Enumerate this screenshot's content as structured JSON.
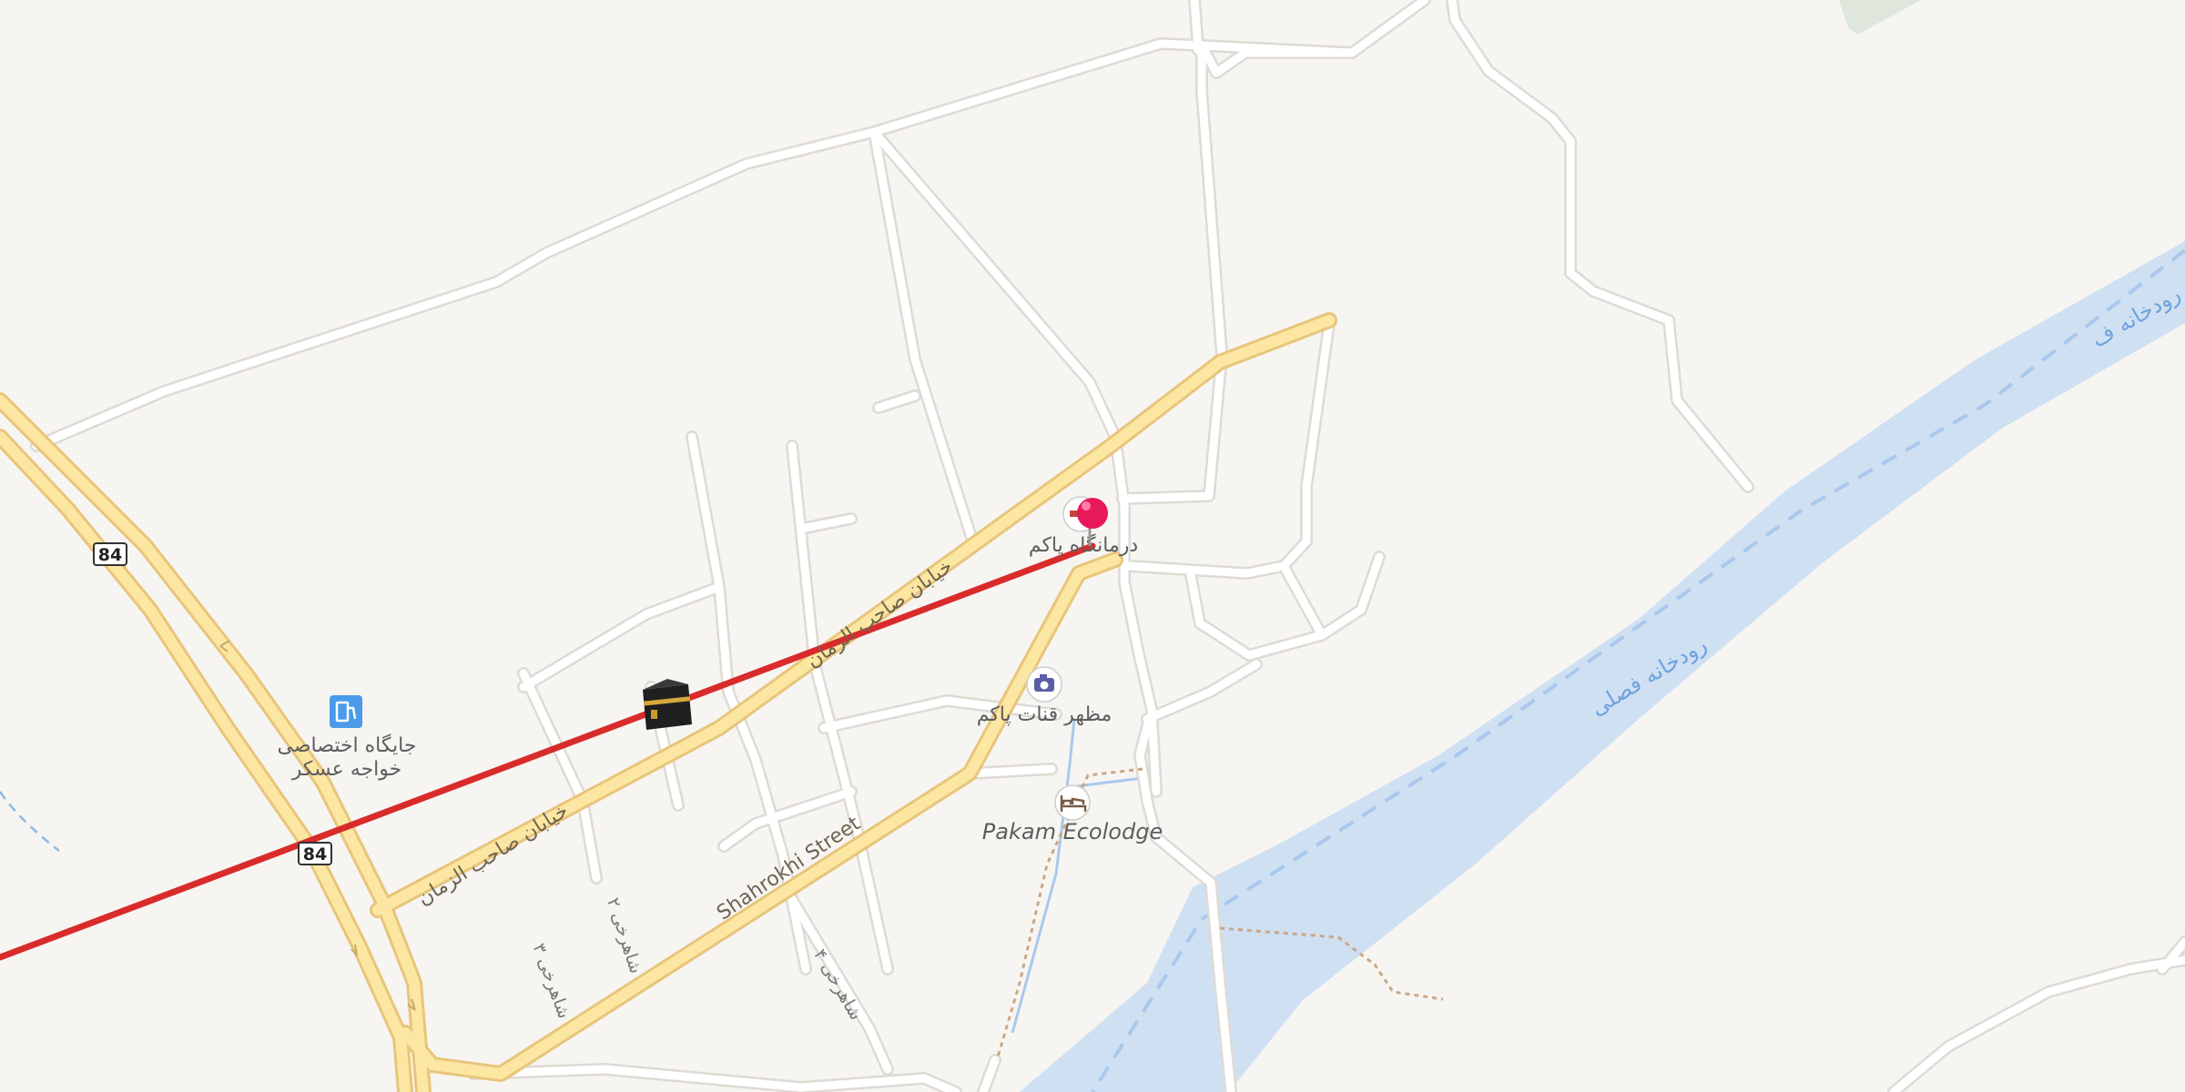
{
  "map": {
    "pois": {
      "fuel_label_line1": "جایگاه اختصاصی",
      "fuel_label_line2": "خواجه عسکر",
      "clinic_label": "درمانگاه پاکم",
      "viewpoint_label": "مظهر قنات پاکم",
      "lodge_label": "Pakam Ecolodge"
    },
    "streets": {
      "shahrokhi": "Shahrokhi Street",
      "saheb_upper": "خیابان صاحب الزمان",
      "saheb_lower": "خیابان صاحب الزمان",
      "shahrokhi_3": "شاهرخی ۳",
      "shahrokhi_2": "شاهرخی ۲",
      "shahrokhi_4": "شاهرخی ۴"
    },
    "river": {
      "label_main": "رودخانه فصلی",
      "label_edge": "رودخانه ف"
    },
    "road_shields": [
      "84",
      "84"
    ],
    "icons": {
      "fuel": "fuel-pump-icon",
      "clinic": "clinic-icon",
      "viewpoint": "camera-icon",
      "lodge": "bed-icon",
      "pin": "red-pin-icon",
      "kaaba": "kaaba-icon"
    },
    "colors": {
      "background": "#f7f5f2",
      "water": "#cfe0f3",
      "primary_road": "#fce7a2",
      "primary_road_casing": "#e8c57b",
      "minor_road": "#ffffff",
      "minor_road_casing": "#dedad4",
      "route": "#d92b2b",
      "pin": "#e8195b"
    }
  }
}
